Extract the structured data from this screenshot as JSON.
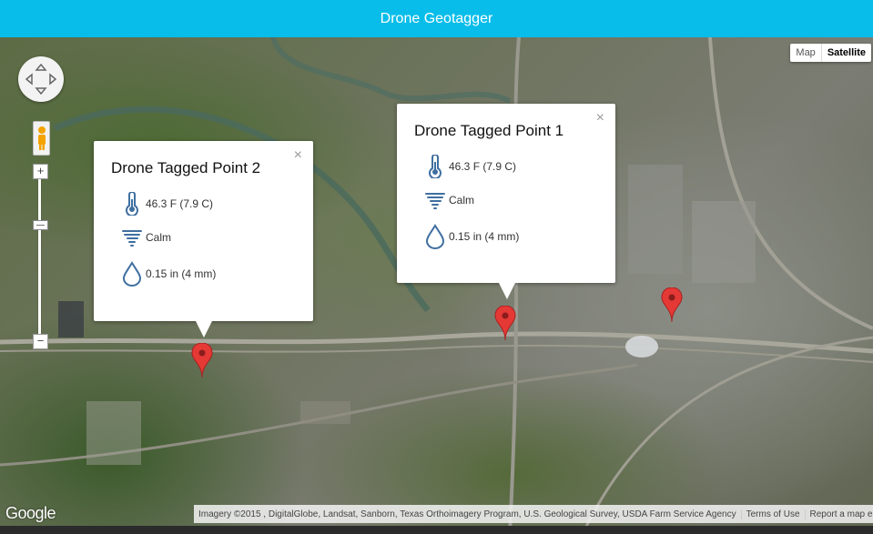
{
  "app": {
    "title": "Drone Geotagger"
  },
  "map": {
    "type_control": {
      "map_label": "Map",
      "satellite_label": "Satellite",
      "selected": "Satellite"
    },
    "logo": "Google",
    "attribution": "Imagery ©2015 , DigitalGlobe, Landsat, Sanborn, Texas Orthoimagery Program, U.S. Geological Survey, USDA Farm Service Agency",
    "terms_label": "Terms of Use",
    "report_label": "Report a map error"
  },
  "info_windows": [
    {
      "title": "Drone Tagged Point 2",
      "close": "×",
      "temperature": "46.3 F (7.9 C)",
      "wind": "Calm",
      "precipitation": "0.15 in (4 mm)"
    },
    {
      "title": "Drone Tagged Point 1",
      "close": "×",
      "temperature": "46.3 F (7.9 C)",
      "wind": "Calm",
      "precipitation": "0.15 in (4 mm)"
    }
  ],
  "markers": [
    "map-marker",
    "map-marker",
    "map-marker"
  ],
  "colors": {
    "header": "#08bdea",
    "marker": "#e53935",
    "icon": "#3f6fa0"
  },
  "icons": [
    "thermometer-icon",
    "tornado-icon",
    "water-drop-icon",
    "map-marker-icon",
    "pegman-icon"
  ]
}
